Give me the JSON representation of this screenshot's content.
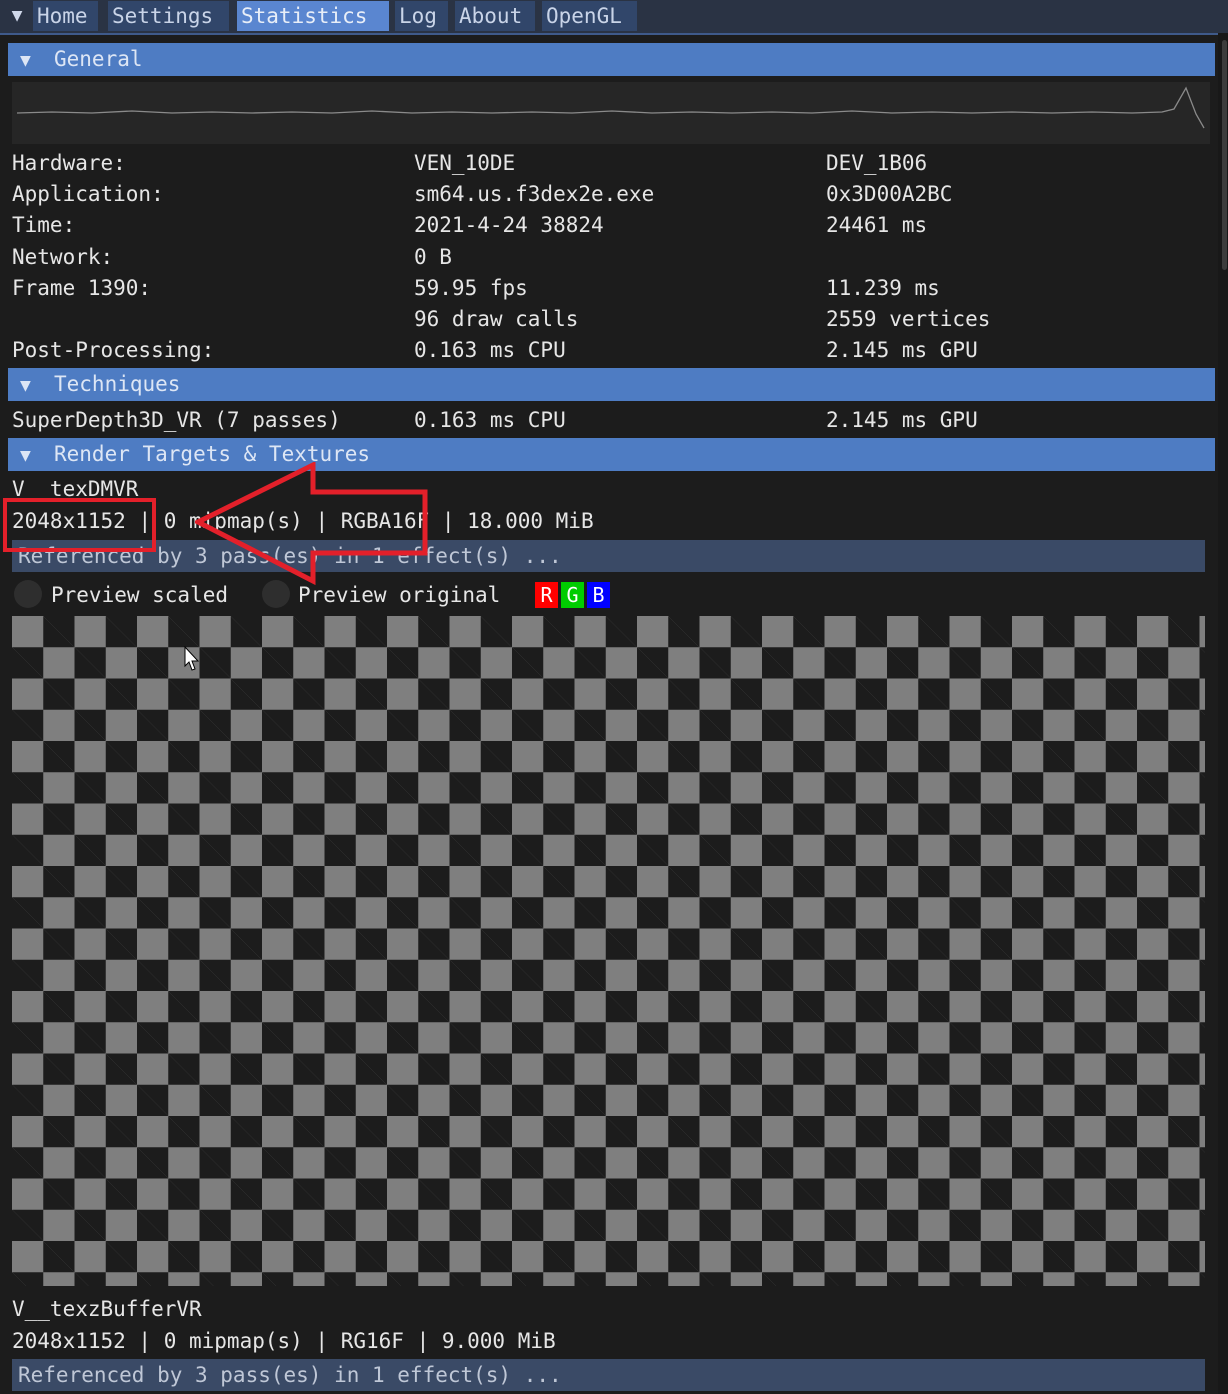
{
  "menu": {
    "icon": "menu-dropdown-icon"
  },
  "tabs": [
    {
      "label": "Home"
    },
    {
      "label": "Settings"
    },
    {
      "label": "Statistics",
      "active": true
    },
    {
      "label": "Log"
    },
    {
      "label": "About"
    },
    {
      "label": "OpenGL"
    }
  ],
  "general": {
    "title": "General",
    "rows": {
      "hardware": {
        "label": "Hardware:",
        "v1": "VEN_10DE",
        "v2": "DEV_1B06"
      },
      "application": {
        "label": "Application:",
        "v1": "sm64.us.f3dex2e.exe",
        "v2": "0x3D00A2BC"
      },
      "time": {
        "label": "Time:",
        "v1": "2021-4-24 38824",
        "v2": "24461 ms"
      },
      "network": {
        "label": "Network:",
        "v1": "0 B"
      },
      "frame": {
        "label": "Frame 1390:",
        "v1": "59.95 fps",
        "v2": "11.239 ms"
      },
      "draw": {
        "v1": "96 draw calls",
        "v2": "2559 vertices"
      },
      "post": {
        "label": "Post-Processing:",
        "v1": "0.163 ms CPU",
        "v2": "2.145 ms GPU"
      }
    }
  },
  "techniques": {
    "title": "Techniques",
    "row": {
      "name": "SuperDepth3D_VR (7 passes)",
      "cpu": "0.163 ms CPU",
      "gpu": "2.145 ms GPU"
    }
  },
  "render_targets": {
    "title": "Render Targets & Textures",
    "tex1": {
      "name": "V__texDMVR",
      "size": "2048x1152",
      "info": " | 0 mipmap(s) | RGBA16F | 18.000 MiB",
      "referenced": "Referenced by 3 pass(es) in 1 effect(s) ..."
    },
    "preview": {
      "scaled": "Preview scaled",
      "original": "Preview original",
      "channels": [
        {
          "label": "R",
          "color": "#ff0000"
        },
        {
          "label": "G",
          "color": "#00cc00"
        },
        {
          "label": "B",
          "color": "#0000ff"
        }
      ]
    },
    "tex2": {
      "name": "V__texzBufferVR",
      "info": "2048x1152 | 0 mipmap(s) | RG16F | 9.000 MiB",
      "referenced": "Referenced by 3 pass(es) in 1 effect(s) ..."
    }
  },
  "colors": {
    "accent_header": "#4e7cc3",
    "active_tab": "#5a86d0",
    "annotation_red": "#e3202a"
  }
}
